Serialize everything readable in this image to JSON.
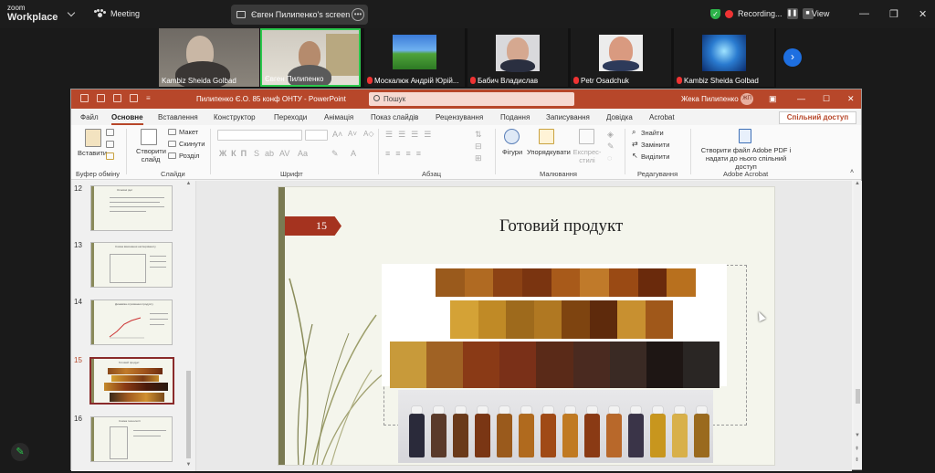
{
  "zoom": {
    "logo_line1": "zoom",
    "logo_line2": "Workplace",
    "meeting_label": "Meeting",
    "share_label": "Євген Пилипенко's screen",
    "recording_label": "Recording...",
    "view_label": "View",
    "participants": [
      {
        "name": "Kambiz Sheida Golbad",
        "muted": false
      },
      {
        "name": "Євген Пилипенко",
        "muted": false
      },
      {
        "name": "Москалюк Андрій Юрій...",
        "muted": true
      },
      {
        "name": "Бабич Владислав",
        "muted": true
      },
      {
        "name": "Petr Osadchuk",
        "muted": true
      },
      {
        "name": "Kambiz Sheida Golbad",
        "muted": true
      }
    ]
  },
  "ppt": {
    "doc_title": "Пилипенко Є.О. 85 конф ОНТУ  -  PowerPoint",
    "search_placeholder": "Пошук",
    "user_name": "Жека Пилипенко",
    "user_initials": "ЖП",
    "tabs": [
      "Файл",
      "Основне",
      "Вставлення",
      "Конструктор",
      "Переходи",
      "Анімація",
      "Показ слайдів",
      "Рецензування",
      "Подання",
      "Записування",
      "Довідка",
      "Acrobat"
    ],
    "share_button": "Спільний доступ",
    "ribbon": {
      "paste": "Вставити",
      "clipboard_group": "Буфер обміну",
      "new_slide": "Створити слайд",
      "layout": "Макет",
      "reset": "Скинути",
      "section": "Розділ",
      "slides_group": "Слайди",
      "font_group": "Шрифт",
      "paragraph_group": "Абзац",
      "shapes": "Фігури",
      "arrange": "Упорядкувати",
      "express_styles": "Експрес-стилі",
      "drawing_group": "Малювання",
      "find": "Знайти",
      "replace": "Замінити",
      "select": "Виділити",
      "editing_group": "Редагування",
      "acrobat_btn": "Створити файл Adobe PDF і надати до нього спільний доступ",
      "acrobat_group": "Adobe Acrobat"
    },
    "thumbnails": [
      {
        "num": "12",
        "title": "Основні ідеї"
      },
      {
        "num": "13",
        "title": "Схема виконання експерименту"
      },
      {
        "num": "14",
        "title": "Динаміка отримання продукту"
      },
      {
        "num": "15",
        "title": "Готовий продукт"
      },
      {
        "num": "16",
        "title": "Схема технології"
      }
    ],
    "slide": {
      "number": "15",
      "title": "Готовий продукт"
    }
  }
}
